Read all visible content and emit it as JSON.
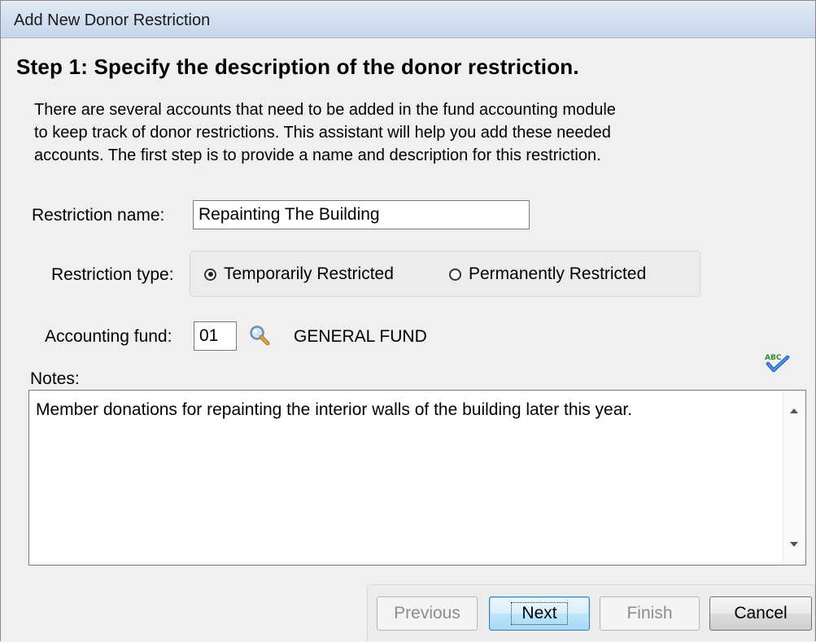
{
  "window": {
    "title": "Add New Donor Restriction"
  },
  "step": {
    "title": "Step 1: Specify the description of the donor restriction.",
    "intro_lines": [
      "There are several accounts that need to be added in the fund accounting module",
      "to keep track of donor restrictions. This assistant will help you add these needed",
      "accounts. The first step is to provide a name and description for this restriction."
    ]
  },
  "form": {
    "restriction_name_label": "Restriction name:",
    "restriction_name_value": "Repainting The Building",
    "restriction_type_label": "Restriction type:",
    "restriction_type_options": [
      {
        "label": "Temporarily Restricted",
        "selected": true
      },
      {
        "label": "Permanently Restricted",
        "selected": false
      }
    ],
    "accounting_fund_label": "Accounting fund:",
    "accounting_fund_value": "01",
    "accounting_fund_name": "GENERAL FUND",
    "notes_label": "Notes:",
    "notes_value": "Member donations for repainting the interior walls of the building later this year."
  },
  "buttons": {
    "previous": "Previous",
    "next": "Next",
    "finish": "Finish",
    "cancel": "Cancel"
  },
  "icons": {
    "lookup": "magnifier-icon",
    "spellcheck": "spellcheck-icon"
  }
}
